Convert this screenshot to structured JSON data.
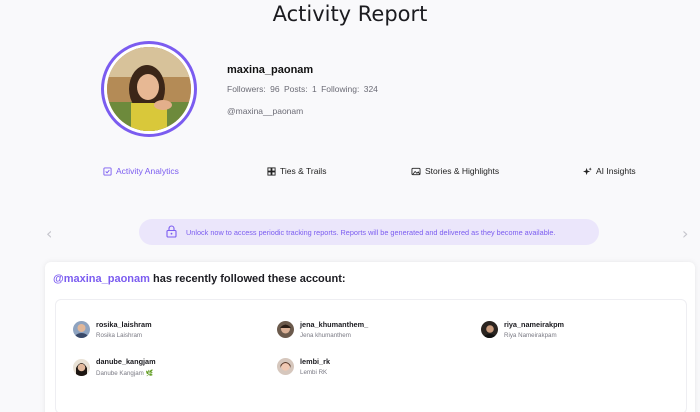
{
  "page": {
    "title": "Activity Report"
  },
  "profile": {
    "username": "maxina_paonam",
    "followers_label": "Followers:",
    "followers": "96",
    "posts_label": "Posts:",
    "posts": "1",
    "following_label": "Following:",
    "following": "324",
    "handle": "@maxina__paonam"
  },
  "tabs": [
    {
      "label": "Activity Analytics",
      "icon": "checklist-icon",
      "active": true
    },
    {
      "label": "Ties & Trails",
      "icon": "grid-icon",
      "active": false
    },
    {
      "label": "Stories & Highlights",
      "icon": "image-icon",
      "active": false
    },
    {
      "label": "AI Insights",
      "icon": "sparkle-icon",
      "active": false
    }
  ],
  "banner": {
    "text": "Unlock now to access periodic tracking reports. Reports will be generated and delivered as they become available."
  },
  "followed": {
    "mention": "@maxina_paonam",
    "title_suffix": " has recently followed these account:",
    "accounts": [
      {
        "username": "rosika_laishram",
        "full_name": "Rosika Laishram"
      },
      {
        "username": "jena_khumanthem_",
        "full_name": "Jena khumanthem"
      },
      {
        "username": "riya_nameirakpm",
        "full_name": "Riya Nameirakpam"
      },
      {
        "username": "danube_kangjam",
        "full_name": "Danube Kangjam 🌿"
      },
      {
        "username": "lembi_rk",
        "full_name": "Lembi RK"
      }
    ]
  },
  "colors": {
    "accent": "#7b5cf0",
    "banner_bg": "#ebe6fb"
  }
}
